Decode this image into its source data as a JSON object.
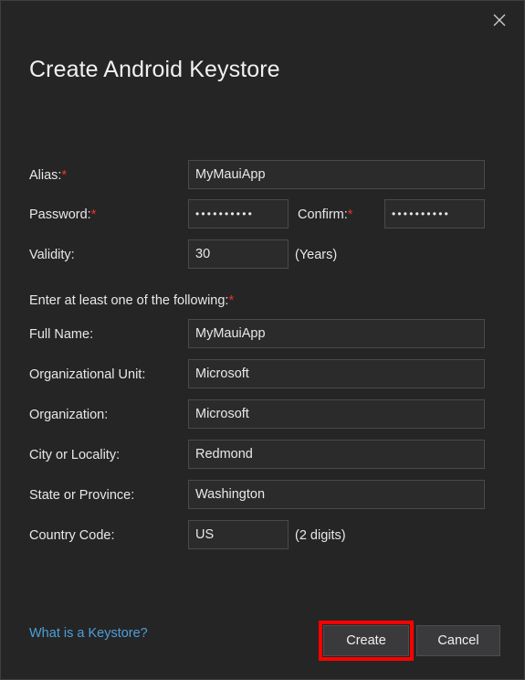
{
  "dialog": {
    "title": "Create Android Keystore",
    "close_icon": "close-icon",
    "section_note": "Enter at least one of the following:",
    "required_marker": "*"
  },
  "fields": {
    "alias": {
      "label": "Alias:",
      "required": true,
      "value": "MyMauiApp",
      "placeholder": ""
    },
    "password": {
      "label": "Password:",
      "required": true,
      "value": "••••••••••",
      "placeholder": ""
    },
    "confirm": {
      "label": "Confirm:",
      "required": true,
      "value": "••••••••••",
      "placeholder": ""
    },
    "validity": {
      "label": "Validity:",
      "required": false,
      "value": "30",
      "suffix": "(Years)",
      "placeholder": ""
    },
    "full_name": {
      "label": "Full Name:",
      "required": false,
      "value": "MyMauiApp",
      "placeholder": ""
    },
    "organizational_unit": {
      "label": "Organizational Unit:",
      "required": false,
      "value": "Microsoft",
      "placeholder": ""
    },
    "organization": {
      "label": "Organization:",
      "required": false,
      "value": "Microsoft",
      "placeholder": ""
    },
    "city": {
      "label": "City or Locality:",
      "required": false,
      "value": "Redmond",
      "placeholder": ""
    },
    "state": {
      "label": "State or Province:",
      "required": false,
      "value": "Washington",
      "placeholder": ""
    },
    "country_code": {
      "label": "Country Code:",
      "required": false,
      "value": "US",
      "suffix": "(2 digits)",
      "placeholder": ""
    }
  },
  "footer": {
    "help_link": "What is a Keystore?",
    "create_label": "Create",
    "cancel_label": "Cancel"
  },
  "colors": {
    "dialog_background": "#252526",
    "field_background": "#2b2b2c",
    "field_border": "#4a4a4c",
    "text": "#e8e8e8",
    "required_red": "#e8342a",
    "link_blue": "#4d9fd8",
    "button_background": "#3a3a3c",
    "highlight_red": "#fe0000"
  }
}
